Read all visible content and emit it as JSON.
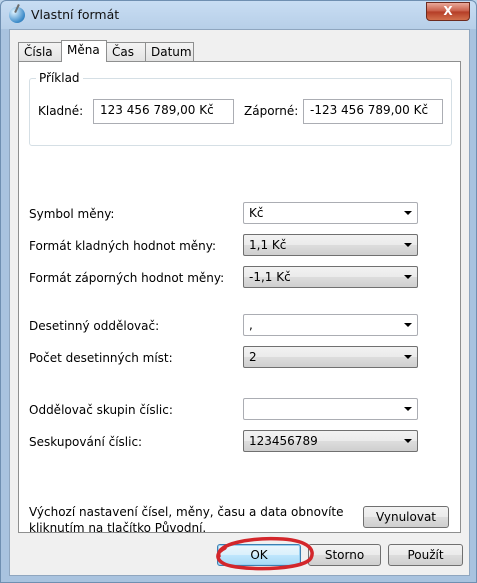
{
  "window": {
    "title": "Vlastní formát",
    "close_label": "X"
  },
  "tabs": [
    {
      "label": "Čísla"
    },
    {
      "label": "Měna"
    },
    {
      "label": "Čas"
    },
    {
      "label": "Datum"
    }
  ],
  "example": {
    "group_title": "Příklad",
    "positive_label": "Kladné:",
    "positive_value": "123 456 789,00 Kč",
    "negative_label": "Záporné:",
    "negative_value": "-123 456 789,00 Kč"
  },
  "settings": [
    {
      "label": "Symbol měny:",
      "value": "Kč"
    },
    {
      "label": "Formát kladných hodnot měny:",
      "value": "1,1 Kč"
    },
    {
      "label": "Formát záporných hodnot měny:",
      "value": "-1,1 Kč"
    },
    {
      "label": "Desetinný oddělovač:",
      "value": ","
    },
    {
      "label": "Počet desetinných míst:",
      "value": "2"
    },
    {
      "label": "Oddělovač skupin číslic:",
      "value": ""
    },
    {
      "label": "Seskupování číslic:",
      "value": "123456789"
    }
  ],
  "footer": {
    "note": "Výchozí nastavení čísel, měny, času a data obnovíte kliknutím na tlačítko Původní.",
    "reset_label": "Vynulovat"
  },
  "buttons": {
    "ok": "OK",
    "cancel": "Storno",
    "apply": "Použít"
  },
  "colors": {
    "title_bar": "#b7cfe8",
    "annotation_circle": "#d3262b",
    "close_button": "#c75b45"
  }
}
